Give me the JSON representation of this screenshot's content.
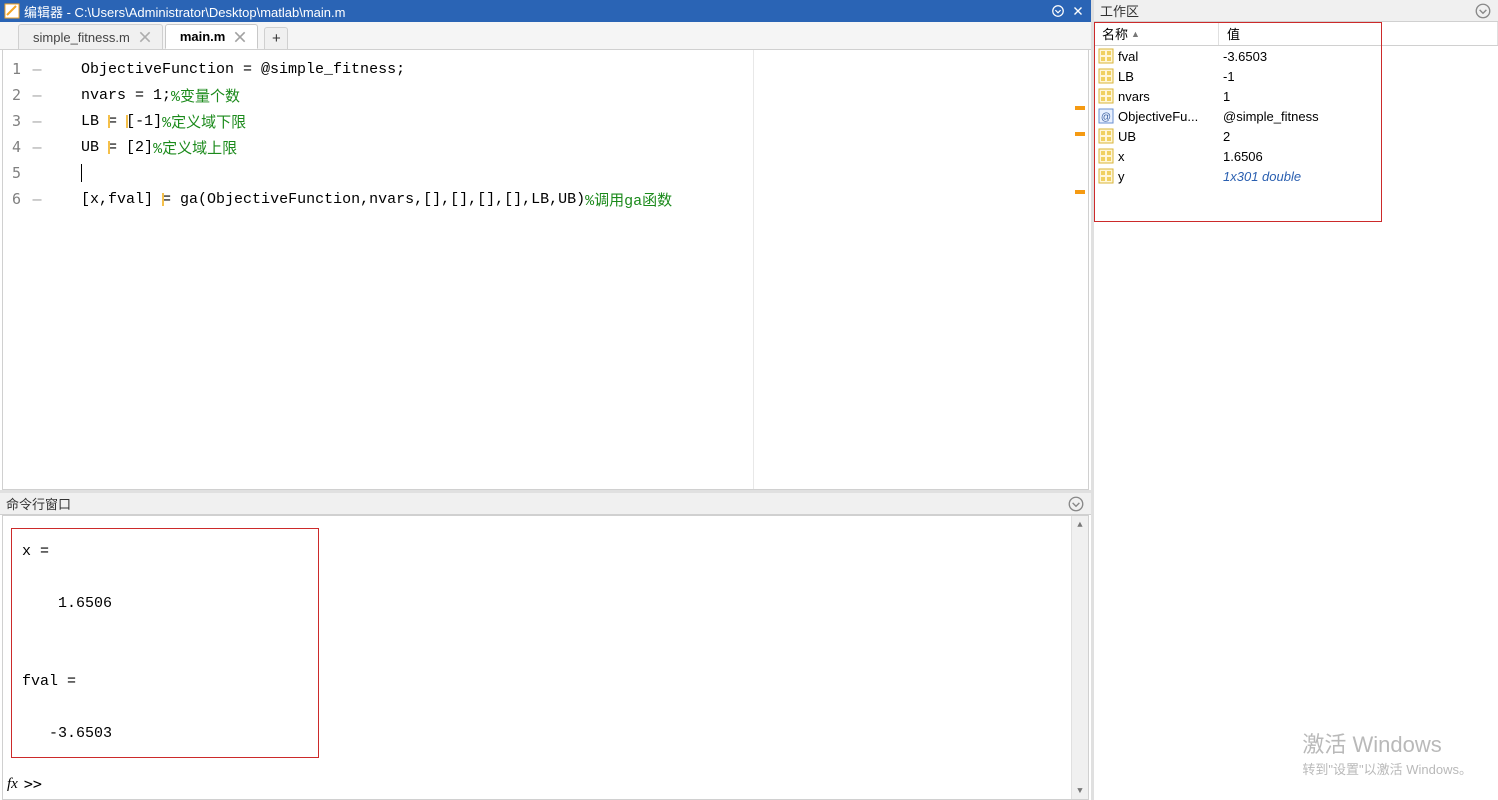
{
  "editor": {
    "title": "编辑器 - C:\\Users\\Administrator\\Desktop\\matlab\\main.m",
    "tabs": [
      {
        "label": "simple_fitness.m",
        "active": false
      },
      {
        "label": "main.m",
        "active": true
      }
    ],
    "lines": [
      {
        "n": "1",
        "plain": "ObjectiveFunction = @simple_fitness;",
        "comment": ""
      },
      {
        "n": "2",
        "plain": "nvars = 1;",
        "comment": "%变量个数"
      },
      {
        "n": "3",
        "plain": "LB = [-1]",
        "comment": "%定义域下限"
      },
      {
        "n": "4",
        "plain": "UB = [2]",
        "comment": "%定义域上限"
      },
      {
        "n": "5",
        "plain": "",
        "comment": ""
      },
      {
        "n": "6",
        "plain": "[x,fval] = ga(ObjectiveFunction,nvars,[],[],[],[],LB,UB)",
        "comment": "%调用ga函数"
      }
    ]
  },
  "command": {
    "title": "命令行窗口",
    "output": "x =\n\n    1.6506\n\n\nfval =\n\n   -3.6503",
    "prompt_fx": "fx",
    "prompt": ">>"
  },
  "workspace": {
    "title": "工作区",
    "cols": {
      "name": "名称",
      "value": "值"
    },
    "vars": [
      {
        "name": "fval",
        "value": "-3.6503",
        "type": "num"
      },
      {
        "name": "LB",
        "value": "-1",
        "type": "num"
      },
      {
        "name": "nvars",
        "value": "1",
        "type": "num"
      },
      {
        "name": "ObjectiveFu...",
        "value": "@simple_fitness",
        "type": "fn"
      },
      {
        "name": "UB",
        "value": "2",
        "type": "num"
      },
      {
        "name": "x",
        "value": "1.6506",
        "type": "num"
      },
      {
        "name": "y",
        "value": "1x301 double",
        "type": "arr"
      }
    ]
  },
  "activate": {
    "big": "激活 Windows",
    "small": "转到\"设置\"以激活 Windows。"
  }
}
